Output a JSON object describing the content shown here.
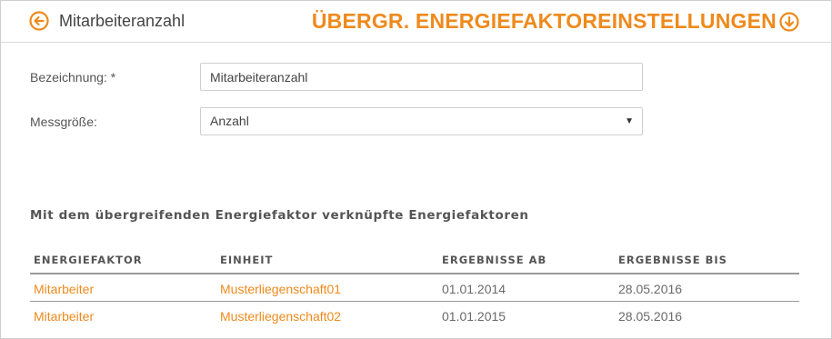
{
  "header": {
    "title": "Mitarbeiteranzahl",
    "section_title": "ÜBERGR. ENERGIEFAKTOREINSTELLUNGEN",
    "back_icon": "arrow-left-circle-icon",
    "collapse_icon": "arrow-down-circle-icon",
    "accent_color": "#ee8a1c"
  },
  "form": {
    "name_label": "Bezeichnung: *",
    "name_value": "Mitarbeiteranzahl",
    "measure_label": "Messgröße:",
    "measure_value": "Anzahl"
  },
  "linked": {
    "title": "Mit dem übergreifenden Energiefaktor verknüpfte Energiefaktoren",
    "columns": [
      "ENERGIEFAKTOR",
      "EINHEIT",
      "ERGEBNISSE AB",
      "ERGEBNISSE BIS"
    ],
    "rows": [
      {
        "faktor": "Mitarbeiter",
        "einheit": "Musterliegenschaft01",
        "ab": "01.01.2014",
        "bis": "28.05.2016"
      },
      {
        "faktor": "Mitarbeiter",
        "einheit": "Musterliegenschaft02",
        "ab": "01.01.2015",
        "bis": "28.05.2016"
      }
    ]
  }
}
